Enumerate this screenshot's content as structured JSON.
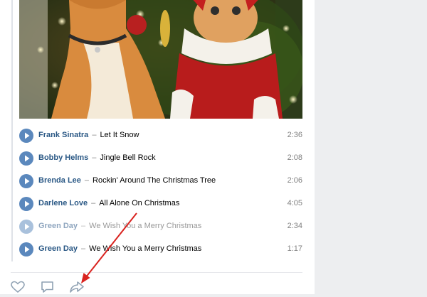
{
  "post": {
    "photo_alt": "Two cats in Christmas outfits",
    "tracks": [
      {
        "artist": "Frank Sinatra",
        "sep": "–",
        "title": "Let It Snow",
        "duration": "2:36",
        "dimmed": false
      },
      {
        "artist": "Bobby Helms",
        "sep": "–",
        "title": "Jingle Bell Rock",
        "duration": "2:08",
        "dimmed": false
      },
      {
        "artist": "Brenda Lee",
        "sep": "–",
        "title": "Rockin' Around The Christmas Tree",
        "duration": "2:06",
        "dimmed": false
      },
      {
        "artist": "Darlene Love",
        "sep": "–",
        "title": "All Alone On Christmas",
        "duration": "4:05",
        "dimmed": false
      },
      {
        "artist": "Green Day",
        "sep": "–",
        "title": "We Wish You a Merry Christmas",
        "duration": "2:34",
        "dimmed": true
      },
      {
        "artist": "Green Day",
        "sep": "–",
        "title": "We Wish You a Merry Christmas",
        "duration": "1:17",
        "dimmed": false
      }
    ]
  },
  "actions": {
    "like_icon": "heart-icon",
    "comment_icon": "comment-icon",
    "share_icon": "share-icon"
  },
  "colors": {
    "link": "#2a5885",
    "play_button": "#5b88bd",
    "annotation_arrow": "#d9231f"
  }
}
